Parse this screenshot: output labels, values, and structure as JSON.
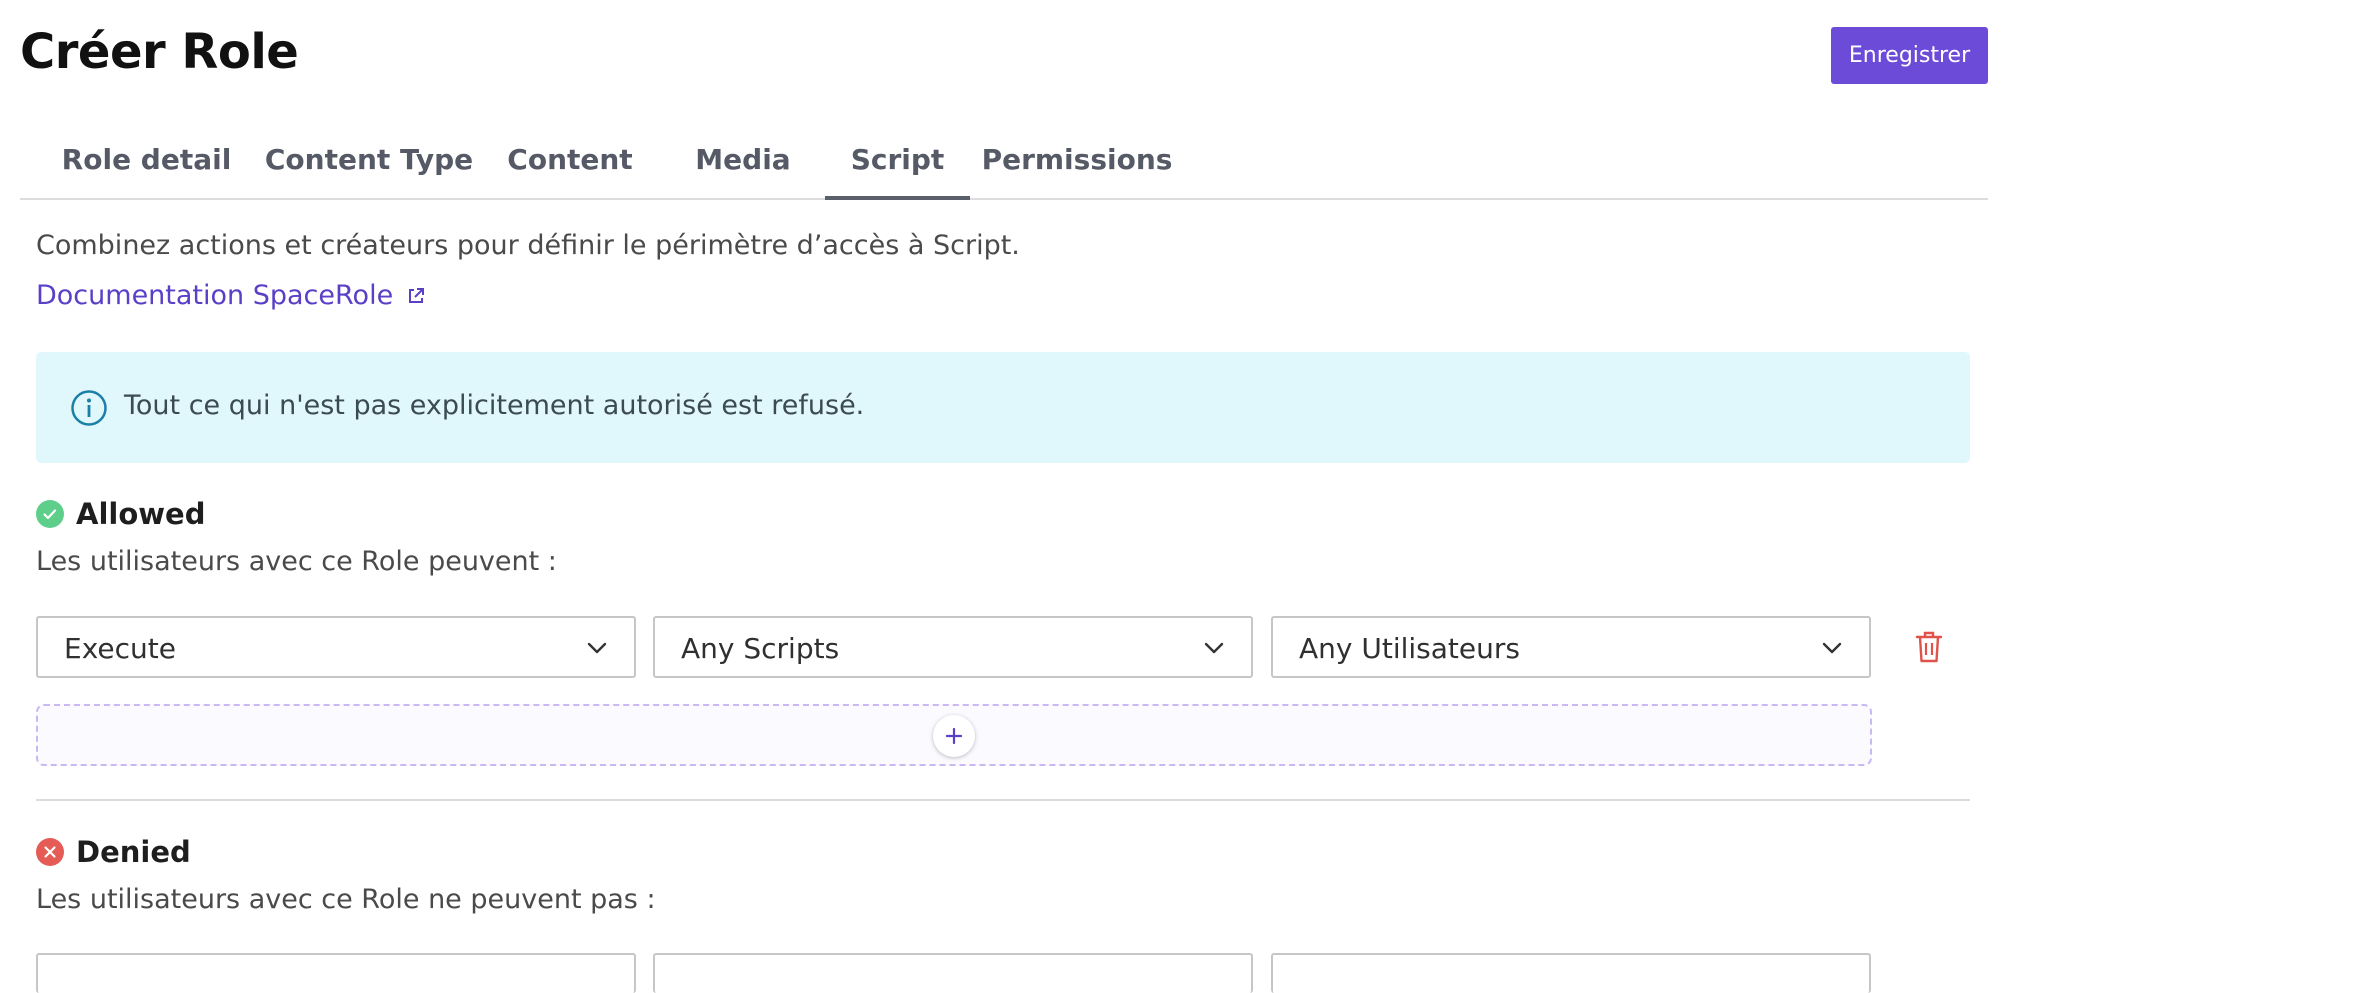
{
  "header": {
    "title": "Créer Role",
    "save_label": "Enregistrer"
  },
  "tabs": [
    {
      "label": "Role detail",
      "active": false
    },
    {
      "label": "Content Type",
      "active": false
    },
    {
      "label": "Content",
      "active": false
    },
    {
      "label": "Media",
      "active": false
    },
    {
      "label": "Script",
      "active": true
    },
    {
      "label": "Permissions",
      "active": false
    }
  ],
  "intro": {
    "text": "Combinez actions et créateurs pour définir le périmètre d’accès à Script.",
    "doc_link": "Documentation SpaceRole"
  },
  "info": {
    "text": "Tout ce qui n'est pas explicitement autorisé est refusé."
  },
  "allowed": {
    "title": "Allowed",
    "description": "Les utilisateurs avec ce Role peuvent :",
    "rule": {
      "action": "Execute",
      "resource": "Any Scripts",
      "creator": "Any Utilisateurs"
    }
  },
  "denied": {
    "title": "Denied",
    "description": "Les utilisateurs avec ce Role ne peuvent pas :"
  },
  "colors": {
    "primary": "#6b4bd8",
    "link": "#5b3fc7",
    "info_bg": "#e0f7fc",
    "allowed": "#5ecf8a",
    "denied": "#e55b55"
  },
  "icons": {
    "info": "info-icon",
    "external": "external-link-icon",
    "allowed": "check-circle-icon",
    "denied": "x-circle-icon",
    "chevron": "chevron-down-icon",
    "delete": "trash-icon",
    "add": "plus-icon"
  }
}
